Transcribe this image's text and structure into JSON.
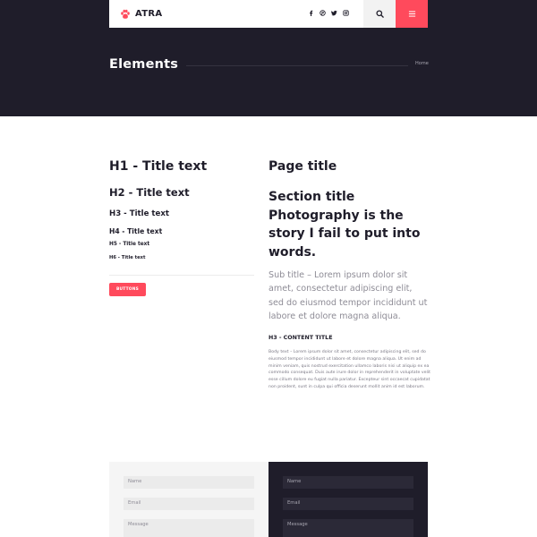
{
  "colors": {
    "dark": "#1f1d2a",
    "accent": "#ff4a5c",
    "light_panel": "#f5f5f5"
  },
  "header": {
    "logo_text": "ATRA",
    "logo_icon": "paw-icon",
    "social": [
      "facebook-icon",
      "pinterest-icon",
      "twitter-icon",
      "instagram-icon"
    ],
    "search_icon": "search-icon",
    "menu_icon": "menu-icon"
  },
  "hero": {
    "title": "Elements",
    "breadcrumb": "Home"
  },
  "headings": {
    "h1": "H1 - Title text",
    "h2": "H2 - Title text",
    "h3": "H3 - Title text",
    "h4": "H4 - Title text",
    "h5": "H5 - Title text",
    "h6": "H6 - Title text"
  },
  "button_label": "BUTTONS",
  "typography": {
    "page_title": "Page title",
    "section_title": "Section title Photography is the story I fail to put into words.",
    "sub_title": "Sub title – Lorem ipsum dolor sit amet, consectetur adipiscing elit, sed do eiusmod tempor incididunt ut labore et dolore magna aliqua.",
    "content_title": "H3 - CONTENT TITLE",
    "body_text": "Body text – Lorem ipsum dolor sit amet, consectetur adipiscing elit, sed do eiusmod tempor incididunt ut labore et dolore magna aliqua. Ut enim ad minim veniam, quis nostrud exercitation ullamco laboris nisi ut aliquip ex ea commodo consequat. Duis aute irure dolor in reprehenderit in voluptate velit esse cillum dolore eu fugiat nulla pariatur. Excepteur sint occaecat cupidatat non proident, sunt in culpa qui officia deserunt mollit anim id est laborum."
  },
  "form_light": {
    "name_placeholder": "Name",
    "email_placeholder": "Email",
    "message_placeholder": "Message"
  },
  "form_dark": {
    "name_placeholder": "Name",
    "email_placeholder": "Email",
    "message_placeholder": "Message"
  }
}
